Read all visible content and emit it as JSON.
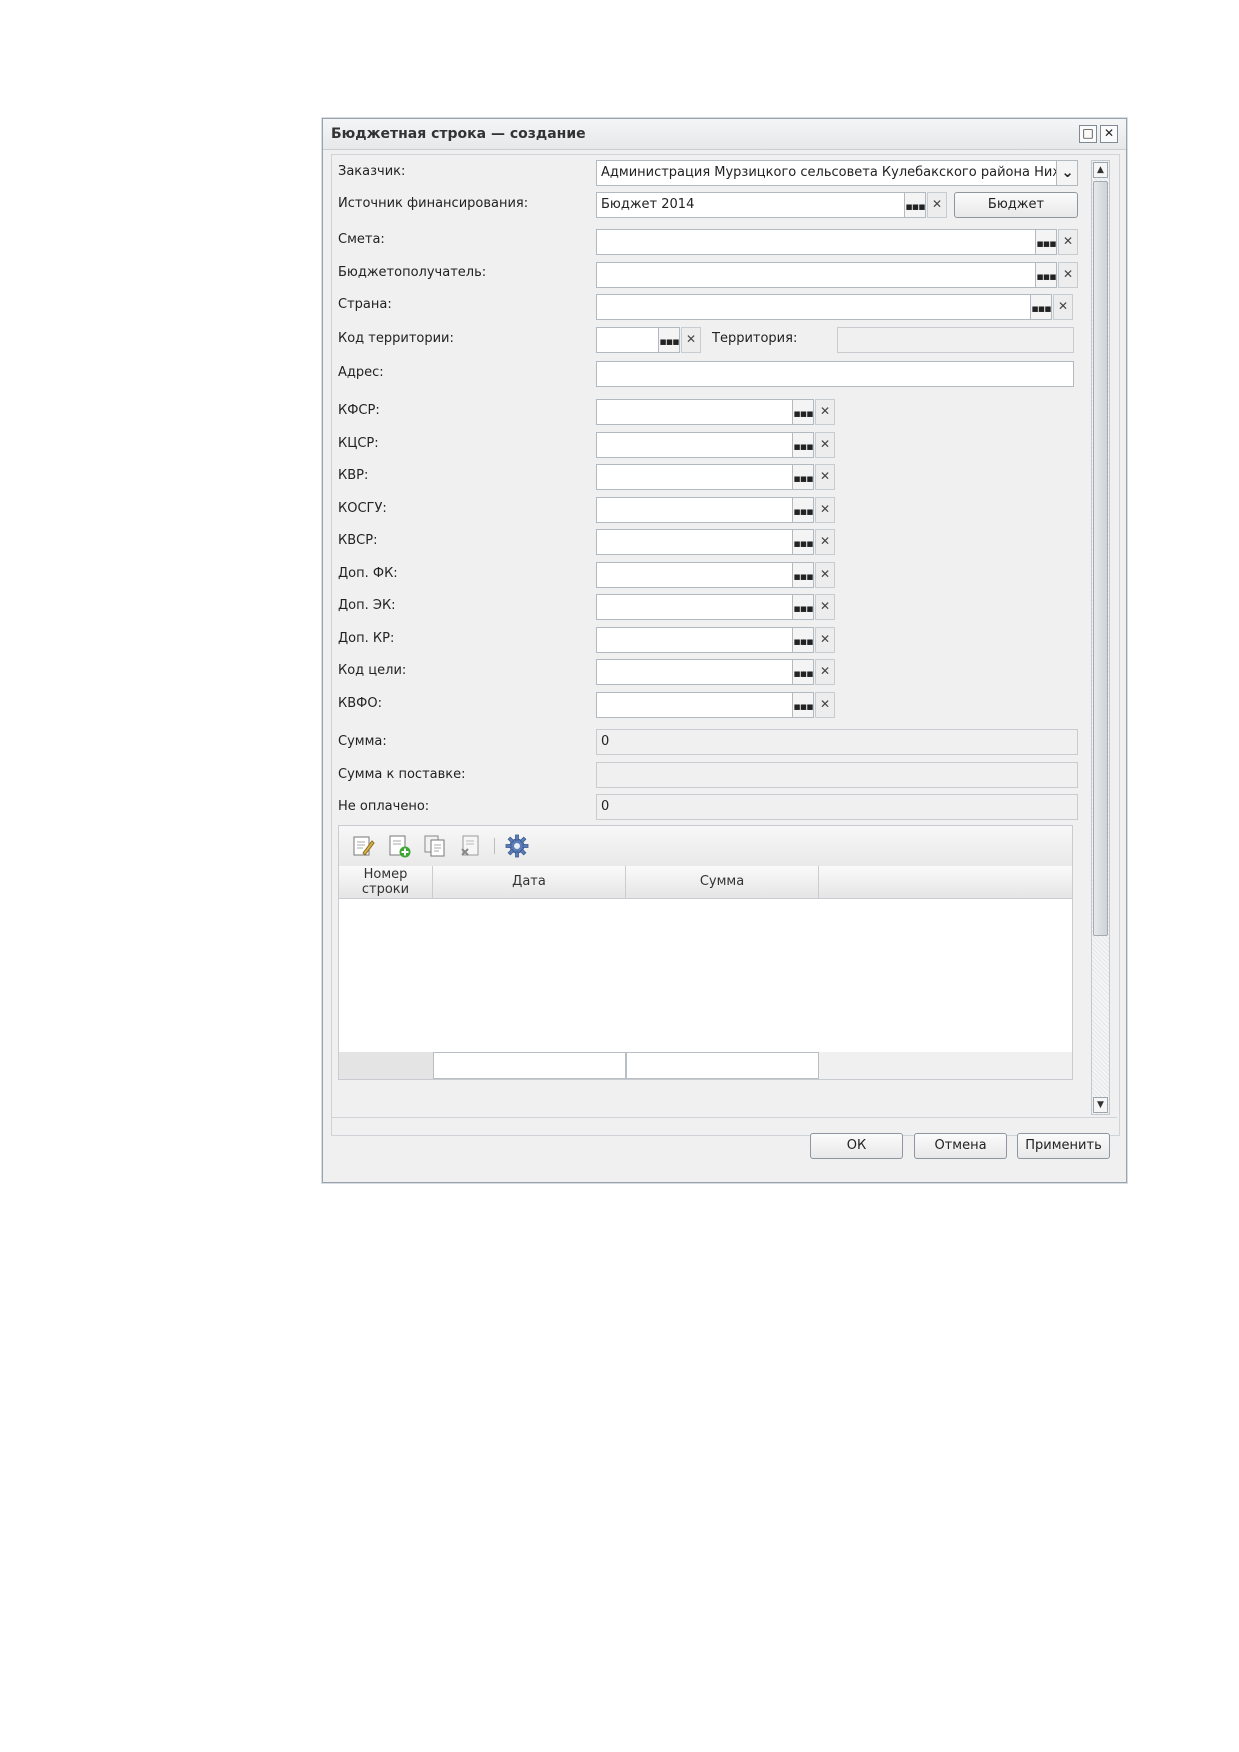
{
  "window": {
    "title": "Бюджетная строка — создание",
    "maximize_glyph": "□",
    "close_glyph": "✕"
  },
  "form": {
    "customer": {
      "label": "Заказчик:",
      "value": "Администрация Мурзицкого сельсовета Кулебакского района Нижегор"
    },
    "funding_source": {
      "label": "Источник финансирования:",
      "value": "Бюджет 2014",
      "button": "Бюджет"
    },
    "estimate": {
      "label": "Смета:",
      "value": ""
    },
    "budget_recipient": {
      "label": "Бюджетополучатель:",
      "value": ""
    },
    "country": {
      "label": "Страна:",
      "value": ""
    },
    "territory_code": {
      "label": "Код территории:",
      "value": ""
    },
    "territory": {
      "label": "Территория:",
      "value": ""
    },
    "address": {
      "label": "Адрес:",
      "value": ""
    },
    "codes": [
      {
        "label": "КФСР:",
        "value": ""
      },
      {
        "label": "КЦСР:",
        "value": ""
      },
      {
        "label": "КВР:",
        "value": ""
      },
      {
        "label": "КОСГУ:",
        "value": ""
      },
      {
        "label": "КВСР:",
        "value": ""
      },
      {
        "label": "Доп. ФК:",
        "value": ""
      },
      {
        "label": "Доп. ЭК:",
        "value": ""
      },
      {
        "label": "Доп. КР:",
        "value": ""
      },
      {
        "label": "Код цели:",
        "value": ""
      },
      {
        "label": "КВФО:",
        "value": ""
      }
    ],
    "sum": {
      "label": "Сумма:",
      "value": "0"
    },
    "sum_to_deliver": {
      "label": "Сумма к поставке:",
      "value": ""
    },
    "unpaid": {
      "label": "Не оплачено:",
      "value": "0"
    }
  },
  "glyphs": {
    "dots": "▪▪▪",
    "clear": "✕",
    "dropdown": "⌄",
    "scroll_up": "▲",
    "scroll_down": "▼"
  },
  "grid": {
    "toolbar": [
      "edit-icon",
      "add-icon",
      "copy-icon",
      "delete-icon",
      "settings-icon"
    ],
    "columns": {
      "row_number_line1": "Номер",
      "row_number_line2": "строки",
      "date": "Дата",
      "sum": "Сумма"
    },
    "rows": []
  },
  "footer": {
    "ok": "ОК",
    "cancel": "Отмена",
    "apply": "Применить"
  }
}
